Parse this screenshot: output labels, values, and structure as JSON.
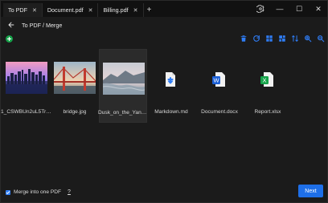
{
  "tabs": [
    {
      "label": "To PDF"
    },
    {
      "label": "Document.pdf"
    },
    {
      "label": "Billing.pdf"
    }
  ],
  "breadcrumb": "To PDF / Merge",
  "files": [
    {
      "name": "1_CSWBUn2uL5TrN...",
      "type": "image",
      "preview": "city"
    },
    {
      "name": "bridge.jpg",
      "type": "image",
      "preview": "bridge"
    },
    {
      "name": "Dusk_on_the_Yangt...",
      "type": "image",
      "preview": "river",
      "selected": true
    },
    {
      "name": "Markdown.md",
      "type": "md",
      "icon": "markdown-file-icon"
    },
    {
      "name": "Document.docx",
      "type": "docx",
      "icon": "word-file-icon"
    },
    {
      "name": "Report.xlsx",
      "type": "xlsx",
      "icon": "excel-file-icon"
    }
  ],
  "footer": {
    "merge_label": "Merge into one PDF",
    "help": "?",
    "next": "Next"
  },
  "colors": {
    "accent": "#1e6fe8",
    "add": "#16a34a",
    "tool_blue": "#2f7df6"
  }
}
